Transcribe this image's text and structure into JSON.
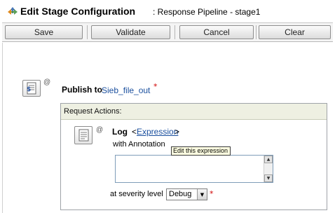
{
  "title": {
    "main": "Edit Stage Configuration",
    "sub": ": Response Pipeline - stage1"
  },
  "toolbar": {
    "save": "Save",
    "validate": "Validate",
    "cancel": "Cancel",
    "clear": "Clear"
  },
  "publish": {
    "label": "Publish to",
    "target": "Sieb_file_out",
    "required": "*",
    "at_symbol": "@"
  },
  "request_actions": {
    "header": "Request Actions:",
    "log": {
      "label": "Log",
      "open_bracket": "<",
      "expression_link": "Expression",
      "close_bracket": ">",
      "at_symbol": "@",
      "annotation_label": "with Annotation",
      "annotation_value": "",
      "tooltip": "Edit this expression",
      "severity_label": "at severity level",
      "severity_value": "Debug",
      "required": "*"
    }
  },
  "icons": {
    "title": "pipeline-stage-icon",
    "publish": "publish-action-icon",
    "log": "log-action-icon"
  },
  "colors": {
    "link": "#1a4f9e",
    "required": "#d00000",
    "panel_header": "#eef0e2",
    "tooltip_bg": "#ffffe1"
  }
}
